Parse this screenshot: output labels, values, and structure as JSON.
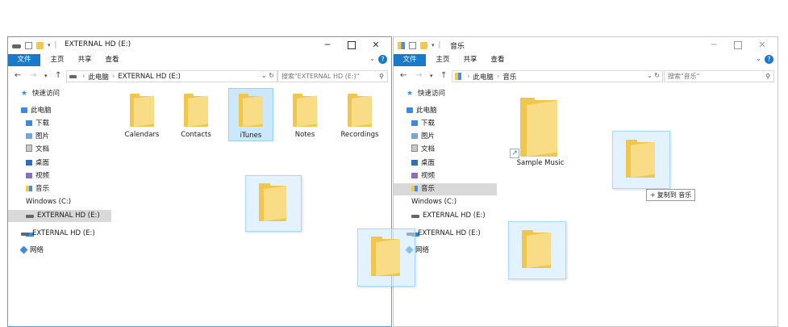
{
  "left_window": {
    "title": "EXTERNAL HD (E:)",
    "ribbon_tabs": [
      "文件",
      "主页",
      "共享",
      "查看"
    ],
    "address": {
      "root": "此电脑",
      "location": "EXTERNAL HD (E:)"
    },
    "search_placeholder": "搜索\"EXTERNAL HD (E:)\"",
    "nav_items": [
      {
        "label": "快速访问",
        "icon": "star-icon"
      },
      {
        "label": "此电脑",
        "icon": "computer-icon"
      },
      {
        "label": "下载",
        "icon": "downloads-icon"
      },
      {
        "label": "图片",
        "icon": "pictures-icon"
      },
      {
        "label": "文档",
        "icon": "documents-icon"
      },
      {
        "label": "桌面",
        "icon": "desktop-icon"
      },
      {
        "label": "视频",
        "icon": "videos-icon"
      },
      {
        "label": "音乐",
        "icon": "music-icon"
      },
      {
        "label": "Windows (C:)",
        "icon": "windows-drive-icon"
      },
      {
        "label": "EXTERNAL HD (E:)",
        "icon": "drive-icon",
        "selected": true
      },
      {
        "label": "EXTERNAL HD (E:)",
        "icon": "drive-icon"
      },
      {
        "label": "网络",
        "icon": "network-icon"
      }
    ],
    "folders": [
      "Calendars",
      "Contacts",
      "iTunes",
      "Notes",
      "Recordings"
    ],
    "selected_folder": "iTunes"
  },
  "right_window": {
    "title": "音乐",
    "ribbon_tabs": [
      "文件",
      "主页",
      "共享",
      "查看"
    ],
    "address": {
      "root": "此电脑",
      "location": "音乐"
    },
    "search_placeholder": "搜索\"音乐\"",
    "nav_items": [
      {
        "label": "快速访问",
        "icon": "star-icon"
      },
      {
        "label": "此电脑",
        "icon": "computer-icon"
      },
      {
        "label": "下载",
        "icon": "downloads-icon"
      },
      {
        "label": "图片",
        "icon": "pictures-icon"
      },
      {
        "label": "文档",
        "icon": "documents-icon"
      },
      {
        "label": "桌面",
        "icon": "desktop-icon"
      },
      {
        "label": "视频",
        "icon": "videos-icon"
      },
      {
        "label": "音乐",
        "icon": "music-icon",
        "selected": true
      },
      {
        "label": "Windows (C:)",
        "icon": "windows-drive-icon"
      },
      {
        "label": "EXTERNAL HD (E:)",
        "icon": "drive-icon"
      },
      {
        "label": "EXTERNAL HD (E:)",
        "icon": "drive-icon"
      },
      {
        "label": "网络",
        "icon": "network-icon"
      }
    ],
    "folders": [
      "Sample Music"
    ],
    "drag_tooltip": "复制到 音乐"
  },
  "colors": {
    "accent": "#1979ca",
    "folder": "#f0c64f",
    "selection": "#cce8ff"
  }
}
